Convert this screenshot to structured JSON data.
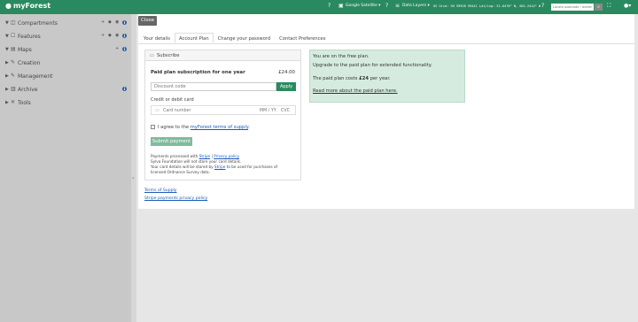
{
  "app": {
    "title": "myForest"
  },
  "topbar": {
    "basemap_label": "Google Satellite",
    "layers_label": "Data Layers",
    "coords_text": "OS Grid: SH 59928 99441  Lat/Lng: 51.6478° N, 001.2414° W",
    "location_placeholder": "Locate postcode / address",
    "search_icon": "search-icon"
  },
  "sidebar": {
    "items": [
      {
        "label": "Compartments",
        "icon": "compartments-icon"
      },
      {
        "label": "Features",
        "icon": "features-icon"
      },
      {
        "label": "Maps",
        "icon": "maps-icon"
      },
      {
        "label": "Creation",
        "icon": "creation-icon"
      },
      {
        "label": "Management",
        "icon": "management-icon"
      },
      {
        "label": "Archive",
        "icon": "archive-icon"
      },
      {
        "label": "Tools",
        "icon": "tools-icon"
      }
    ]
  },
  "main": {
    "close_label": "Close",
    "tabs": [
      {
        "label": "Your details"
      },
      {
        "label": "Account Plan"
      },
      {
        "label": "Change your password"
      },
      {
        "label": "Contact Preferences"
      }
    ],
    "subscribe": {
      "title": "Subscribe",
      "plan_name": "Paid plan subscription for one year",
      "plan_price": "£24.00",
      "discount_placeholder": "Discount code",
      "apply_label": "Apply",
      "card_label": "Credit or debit card",
      "card_number_placeholder": "Card number",
      "card_expiry_placeholder": "MM / YY",
      "card_cvc_placeholder": "CVC",
      "agree_prefix": "I agree to the ",
      "agree_link": "myForest terms of supply",
      "agree_suffix": ".",
      "submit_label": "Submit payment",
      "processed_prefix": "Payments processed with ",
      "processed_link1": "Stripe",
      "processed_sep": " | ",
      "processed_link2": "Privacy policy",
      "fine2": "Sylva Foundation will not store your card details.",
      "fine3_prefix": "Your card details will be stored by ",
      "fine3_link": "Stripe",
      "fine3_suffix": " to be used for purchases of",
      "fine4": "licensed Ordnance Survey data."
    },
    "info": {
      "line1": "You are on the free plan.",
      "line2": "Upgrade to the paid plan for extended functionality.",
      "line3_prefix": "The paid plan costs ",
      "line3_bold": "£24",
      "line3_suffix": " per year.",
      "link": "Read more about the paid plan here."
    },
    "links": {
      "terms": "Terms of Supply",
      "stripe_privacy": "Stripe payments privacy policy"
    }
  }
}
